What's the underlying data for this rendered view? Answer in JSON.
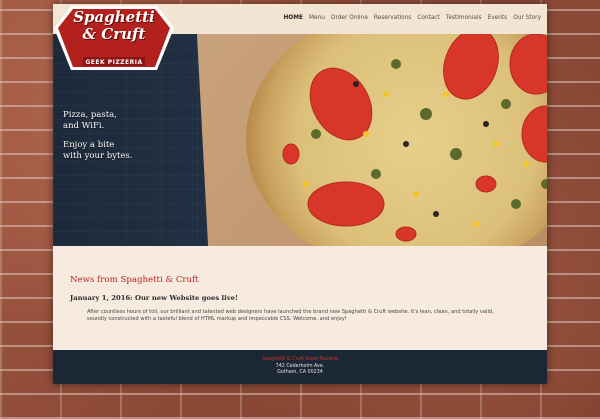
{
  "logo": {
    "line1": "Spaghetti",
    "line2": "& Cruft",
    "subtitle": "GEEK PIZZERIA",
    "color": "#b3211e"
  },
  "nav": {
    "items": [
      "HOME",
      "Menu",
      "Order Online",
      "Reservations",
      "Contact",
      "Testimonials",
      "Events",
      "Our Story"
    ],
    "active": "HOME"
  },
  "hero": {
    "tagline1": [
      "Pizza, pasta,",
      "and WiFi."
    ],
    "tagline2": [
      "Enjoy a bite",
      "with your bytes."
    ]
  },
  "news": {
    "heading": "News from Spaghetti & Cruft",
    "post_title": "January 1, 2016: Our new Website goes live!",
    "post_body": "After countless hours of toil, our brilliant and talented web designers have launched the brand new Spaghetti & Cruft website. It's lean, clean, and totally valid, soundly constructed with a tasteful blend of HTML markup and impeccable CSS. Welcome, and enjoy!"
  },
  "footer": {
    "name": "Spaghetti & Cruft Geek Pizzeria",
    "address1": "742 Cederholm Ave.",
    "address2": "Gotham, CA 00234"
  }
}
